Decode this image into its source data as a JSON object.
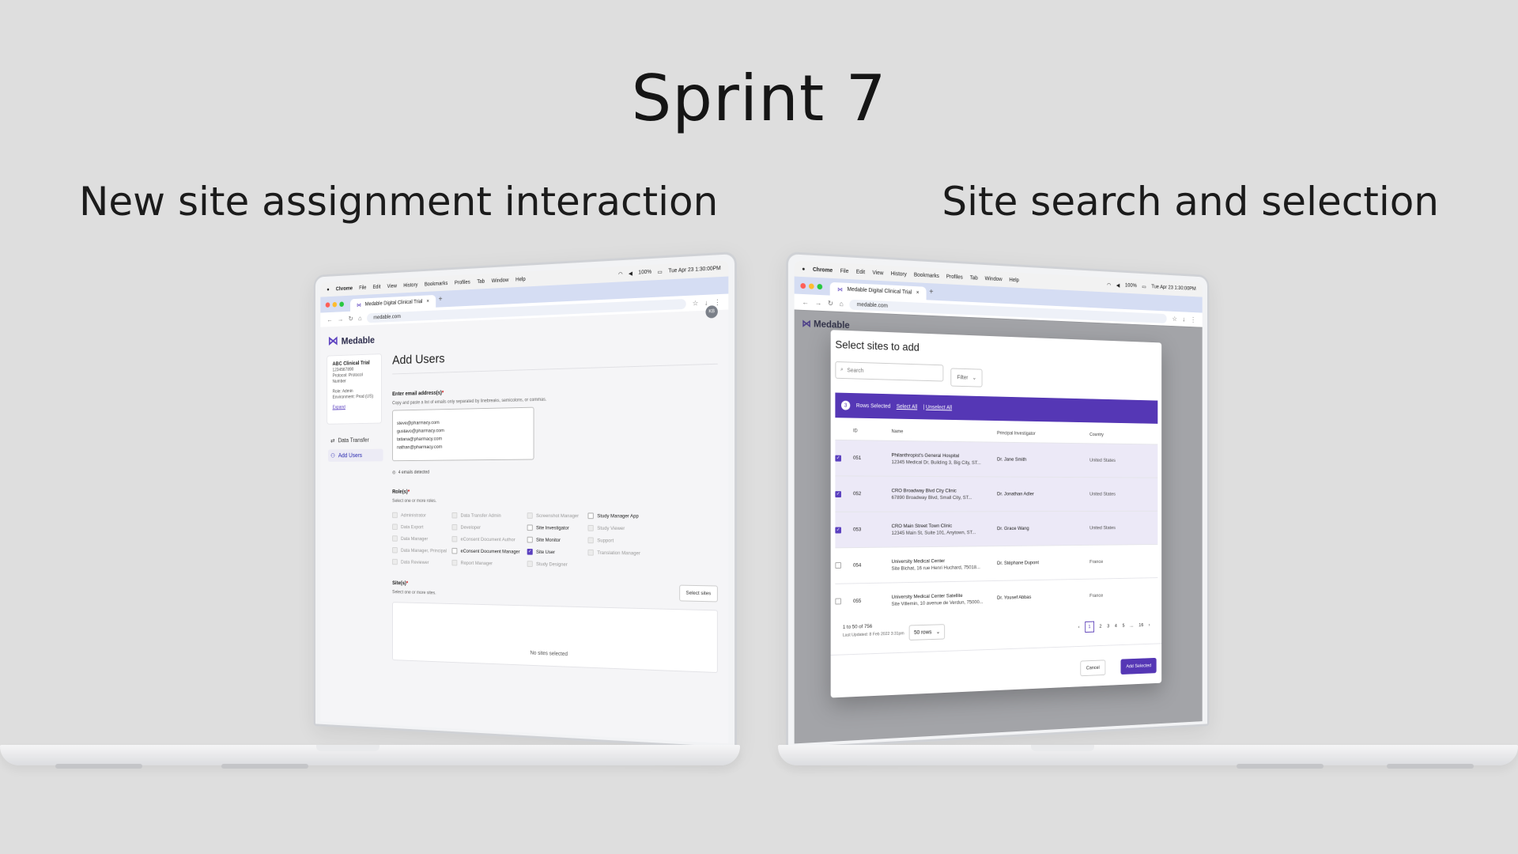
{
  "page": {
    "title": "Sprint 7",
    "subtitle_left": "New site assignment interaction",
    "subtitle_right": "Site search and selection"
  },
  "browser": {
    "menu": [
      "Chrome",
      "File",
      "Edit",
      "View",
      "History",
      "Bookmarks",
      "Profiles",
      "Tab",
      "Window",
      "Help"
    ],
    "tab_title": "Medable Digital Clinical Trial",
    "address": "medable.com",
    "clock": "Tue Apr 23 1:30:00PM",
    "battery": "100%"
  },
  "left_app": {
    "brand": "Medable",
    "avatar": "KB",
    "study": {
      "name": "ABC Clinical Trial",
      "id": "1234567890",
      "protocol": "Protocol: Protocol Number",
      "role": "Role: Admin",
      "environment": "Environment: Prod (US)",
      "expand": "Expand"
    },
    "nav": [
      {
        "label": "Data Transfer"
      },
      {
        "label": "Add Users"
      }
    ],
    "heading": "Add Users",
    "email_label": "Enter email address(s)",
    "email_help": "Copy and paste a list of emails only separated by linebreaks, semicolons, or commas.",
    "emails": [
      "steve@pharmacy.com",
      "gustavo@pharmacy.com",
      "tatiana@pharmacy.com",
      "nathan@pharmacy.com"
    ],
    "emails_detected": "4 emails detected",
    "roles_label": "Role(s)",
    "roles_help": "Select one or more roles.",
    "roles": [
      {
        "label": "Administrator",
        "state": "disabled"
      },
      {
        "label": "Data Transfer Admin",
        "state": "disabled"
      },
      {
        "label": "Screenshot Manager",
        "state": "disabled"
      },
      {
        "label": "Study Manager App",
        "state": "enabled"
      },
      {
        "label": "Data Export",
        "state": "disabled"
      },
      {
        "label": "Developer",
        "state": "disabled"
      },
      {
        "label": "Site Investigator",
        "state": "enabled"
      },
      {
        "label": "Study Viewer",
        "state": "disabled"
      },
      {
        "label": "Data Manager",
        "state": "disabled"
      },
      {
        "label": "eConsent Document Author",
        "state": "disabled"
      },
      {
        "label": "Site Monitor",
        "state": "enabled"
      },
      {
        "label": "Support",
        "state": "disabled"
      },
      {
        "label": "Data Manager, Principal",
        "state": "disabled"
      },
      {
        "label": "eConsent Document Manager",
        "state": "enabled"
      },
      {
        "label": "Site User",
        "state": "checked"
      },
      {
        "label": "Translation Manager",
        "state": "disabled"
      },
      {
        "label": "Data Reviewer",
        "state": "disabled"
      },
      {
        "label": "Report Manager",
        "state": "disabled"
      },
      {
        "label": "Study Designer",
        "state": "disabled"
      },
      {
        "label": "",
        "state": "none"
      }
    ],
    "sites_label": "Site(s)",
    "sites_help": "Select one or more sites.",
    "select_sites_button": "Select sites",
    "no_sites": "No sites selected"
  },
  "right_app": {
    "brand": "Medable",
    "modal_title": "Select sites to add",
    "search_placeholder": "Search",
    "filter_label": "Filter",
    "selected_count": "3",
    "selected_label": "Rows Selected",
    "select_all": "Select All",
    "unselect_all": "Unselect All",
    "columns": [
      "ID",
      "Name",
      "Principal Investigator",
      "Country"
    ],
    "rows": [
      {
        "id": "051",
        "name": "Philanthropist's General Hospital",
        "address": "12345 Medical Dr, Building 3, Big City, ST...",
        "pi": "Dr. Jane Smith",
        "country": "United States",
        "checked": true
      },
      {
        "id": "052",
        "name": "CRO Broadway Blvd City Clinic",
        "address": "67890 Broadway Blvd, Small City, ST...",
        "pi": "Dr. Jonathan Adler",
        "country": "United States",
        "checked": true
      },
      {
        "id": "053",
        "name": "CRO Main Street Town Clinic",
        "address": "12345 Main St, Suite 101, Anytown, ST...",
        "pi": "Dr. Grace Wang",
        "country": "United States",
        "checked": true
      },
      {
        "id": "054",
        "name": "University Medical Center",
        "address": "Site Bichat, 16 rue Henri Huchard, 75018...",
        "pi": "Dr. Stéphane Dupont",
        "country": "France",
        "checked": false
      },
      {
        "id": "055",
        "name": "University Medical Center Satellite",
        "address": "Site Villemin, 10 avenue de Verdun, 75000...",
        "pi": "Dr. Yousef Abbas",
        "country": "France",
        "checked": false
      }
    ],
    "range": "1 to 50 of 756",
    "last_updated": "Last Updated: 8 Feb 2022 3:31pm",
    "rows_per_page": "50 rows",
    "pages": [
      "1",
      "2",
      "3",
      "4",
      "5",
      "...",
      "16"
    ],
    "current_page": "1",
    "cancel": "Cancel",
    "add_selected": "Add Selected"
  }
}
